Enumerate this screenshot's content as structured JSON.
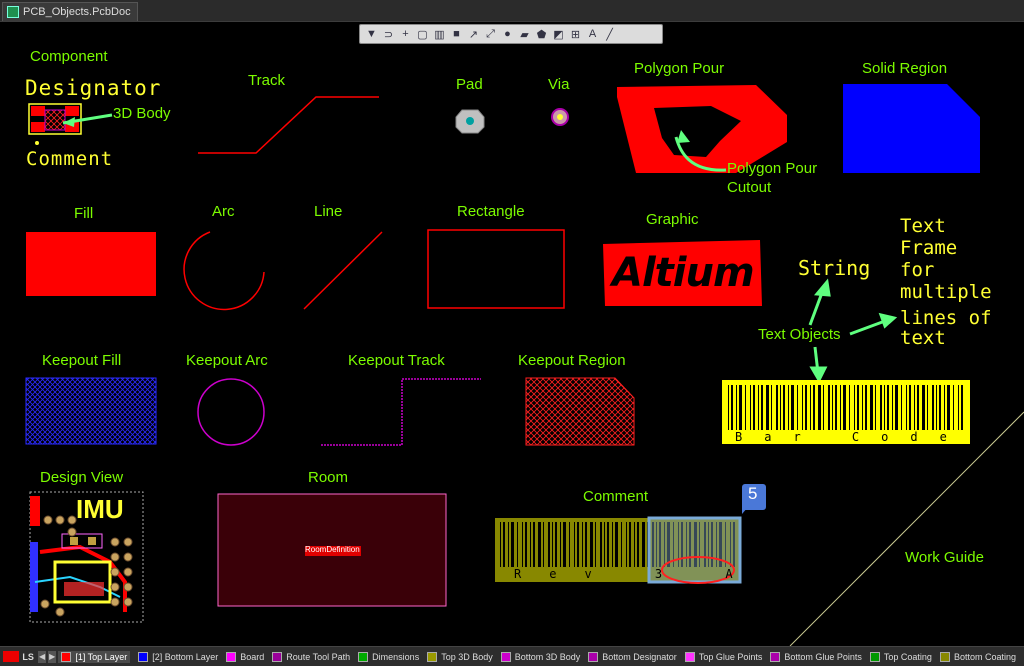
{
  "tab": {
    "title": "PCB_Objects.PcbDoc"
  },
  "toolbar": {
    "tools": [
      "filter-icon",
      "route-icon",
      "cross-icon",
      "select-box-icon",
      "chart-icon",
      "component-icon",
      "interactive-route-icon",
      "pad-icon",
      "fill-icon",
      "polygon-icon",
      "dimension-icon",
      "text-icon",
      "line-icon"
    ]
  },
  "labels": {
    "component": "Component",
    "designator": "Designator",
    "body3d": "3D Body",
    "comment_text": "Comment",
    "track": "Track",
    "pad": "Pad",
    "via": "Via",
    "polygon_pour": "Polygon Pour",
    "polygon_cutout_1": "Polygon Pour",
    "polygon_cutout_2": "Cutout",
    "solid_region": "Solid Region",
    "fill": "Fill",
    "arc": "Arc",
    "line": "Line",
    "rectangle": "Rectangle",
    "graphic": "Graphic",
    "graphic_logo": "Altium",
    "string": "String",
    "text_frame": [
      "Text",
      "Frame",
      "for",
      "multiple",
      "lines of",
      "text"
    ],
    "text_objects": "Text Objects",
    "keepout_fill": "Keepout Fill",
    "keepout_arc": "Keepout Arc",
    "keepout_track": "Keepout Track",
    "keepout_region": "Keepout Region",
    "barcode_text": "Bar Code",
    "design_view": "Design View",
    "design_view_logo": "IMU",
    "room": "Room",
    "room_definition": "RoomDefinition",
    "comment": "Comment",
    "comment_badge": "5",
    "comment_barcode_text": "Rev 3 A",
    "work_guide": "Work Guide"
  },
  "statusbar": {
    "ls": "LS",
    "layers": [
      {
        "name": "[1] Top Layer",
        "color": "#ff0000",
        "active": true
      },
      {
        "name": "[2] Bottom Layer",
        "color": "#0000ff",
        "active": false
      },
      {
        "name": "Board",
        "color": "#ff00ff",
        "active": false
      },
      {
        "name": "Route Tool Path",
        "color": "#990099",
        "active": false
      },
      {
        "name": "Dimensions",
        "color": "#00aa00",
        "active": false
      },
      {
        "name": "Top 3D Body",
        "color": "#999900",
        "active": false
      },
      {
        "name": "Bottom 3D Body",
        "color": "#cc00cc",
        "active": false
      },
      {
        "name": "Bottom Designator",
        "color": "#aa00aa",
        "active": false
      },
      {
        "name": "Top Glue Points",
        "color": "#ff33ff",
        "active": false
      },
      {
        "name": "Bottom Glue Points",
        "color": "#aa00aa",
        "active": false
      },
      {
        "name": "Top Coating",
        "color": "#009900",
        "active": false
      },
      {
        "name": "Bottom Coating",
        "color": "#888800",
        "active": false
      }
    ]
  },
  "colors": {
    "label": "#7CFC00",
    "top_layer": "#ff0000",
    "bottom_layer": "#0000ff",
    "keepout": "#cc00cc",
    "text": "#ffff33"
  }
}
